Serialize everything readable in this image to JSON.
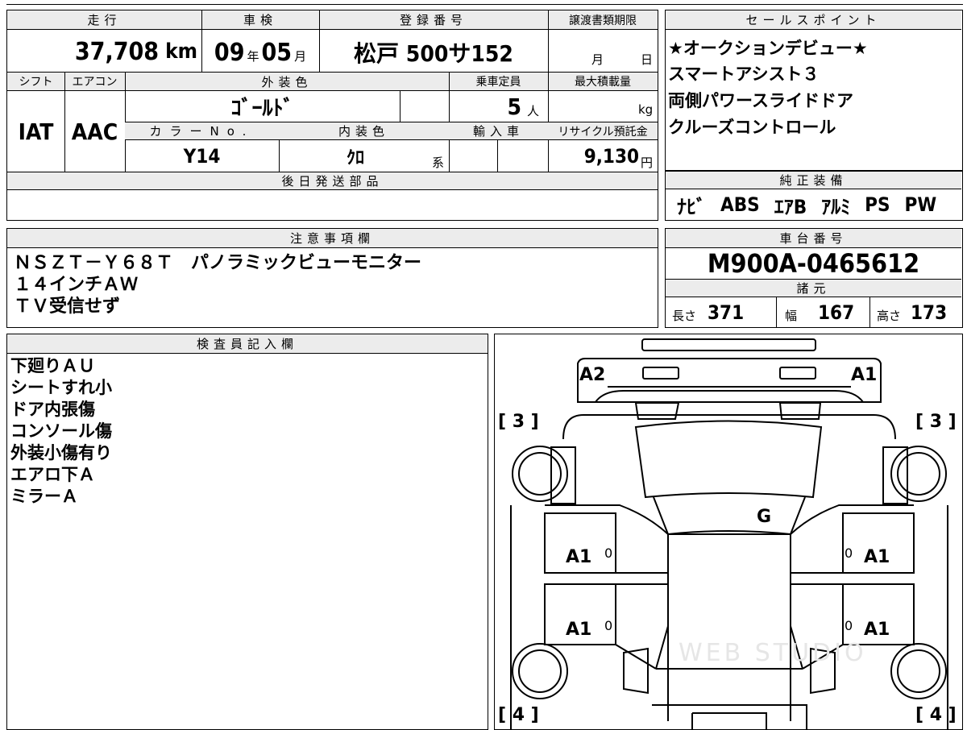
{
  "top": {
    "mileage_label": "走行",
    "mileage_value": "37,708",
    "mileage_unit": "km",
    "inspection_label": "車検",
    "inspection_year": "09",
    "inspection_year_unit": "年",
    "inspection_month": "05",
    "inspection_month_unit": "月",
    "registration_label": "登録番号",
    "registration_value": "松戸 500サ152",
    "transfer_label": "譲渡書類期限",
    "transfer_month_unit": "月",
    "transfer_day_unit": "日"
  },
  "mid": {
    "shift_label": "シフト",
    "shift_value": "IAT",
    "ac_label": "エアコン",
    "ac_value": "AAC",
    "exterior_label": "外装色",
    "exterior_value": "ｺﾞｰﾙﾄﾞ",
    "capacity_label": "乗車定員",
    "capacity_value": "5",
    "capacity_unit": "人",
    "max_load_label": "最大積載量",
    "max_load_unit": "kg",
    "color_no_label": "カラーNo.",
    "color_no_value": "Y14",
    "interior_label": "内装色",
    "interior_value": "ｸﾛ",
    "interior_unit": "系",
    "import_label": "輸入車",
    "recycle_label": "リサイクル預託金",
    "recycle_value": "9,130",
    "recycle_unit": "円"
  },
  "later_parts_label": "後日発送部品",
  "sales": {
    "label": "セールスポイント",
    "lines": [
      "★オークションデビュー★",
      "スマートアシスト３",
      "両側パワースライドドア",
      "クルーズコントロール"
    ]
  },
  "equipment": {
    "label": "純正装備",
    "items": [
      "ﾅﾋﾞ",
      "ABS",
      "ｴｱB",
      "ｱﾙﾐ",
      "PS",
      "PW"
    ]
  },
  "notes": {
    "label": "注意事項欄",
    "lines": [
      "ＮＳＺＴ－Ｙ６８Ｔ　パノラミックビューモニター",
      "１４インチＡＷ",
      "ＴＶ受信せず"
    ]
  },
  "chassis": {
    "label": "車台番号",
    "value": "M900A-0465612"
  },
  "specs": {
    "label": "諸元",
    "length_label": "長さ",
    "length_value": "371",
    "width_label": "幅",
    "width_value": "167",
    "height_label": "高さ",
    "height_value": "173"
  },
  "inspector": {
    "label": "検査員記入欄",
    "lines": [
      "下廻りＡＵ",
      "シートすれ小",
      "ドア内張傷",
      "コンソール傷",
      "外装小傷有り",
      "エアロ下Ａ",
      "ミラーＡ"
    ]
  },
  "diagram": {
    "front_left": "A2",
    "front_right": "A1",
    "left_front_bracket": "[ 3 ]",
    "right_front_bracket": "[ 3 ]",
    "windshield": "G",
    "door_fl": "A1",
    "door_fl_small": "0",
    "door_fr_small": "0",
    "door_fr": "A1",
    "door_rl": "A1",
    "door_rl_small": "0",
    "door_rr_small": "0",
    "door_rr": "A1",
    "left_rear_bracket": "[ 4 ]",
    "right_rear_bracket": "[ 4 ]",
    "watermark": "WEB STUDIO"
  }
}
